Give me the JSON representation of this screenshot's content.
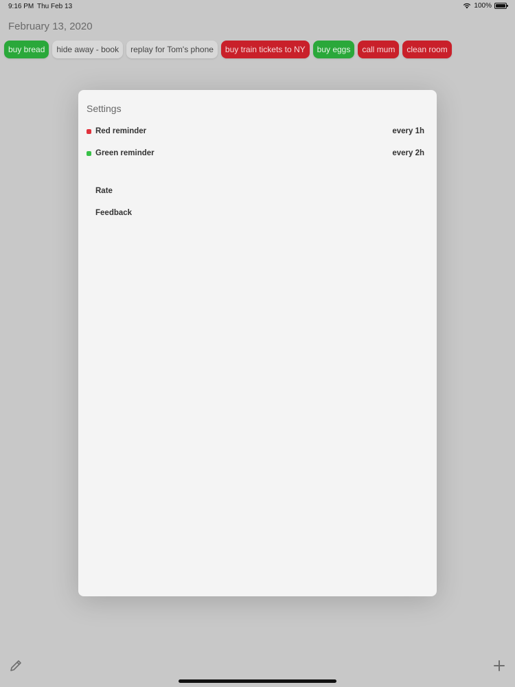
{
  "status_bar": {
    "time": "9:16 PM",
    "date": "Thu Feb 13",
    "battery": "100%",
    "battery_level": 1.0
  },
  "header": {
    "date": "February 13, 2020"
  },
  "reminders": [
    {
      "label": "buy bread",
      "color": "green"
    },
    {
      "label": "hide away - book",
      "color": "gray"
    },
    {
      "label": "replay for Tom's phone",
      "color": "gray"
    },
    {
      "label": "buy train tickets to NY",
      "color": "red"
    },
    {
      "label": "buy eggs",
      "color": "green"
    },
    {
      "label": "call mum",
      "color": "red"
    },
    {
      "label": "clean room",
      "color": "red"
    }
  ],
  "colors": {
    "green": "#2aa83a",
    "red": "#c9202a",
    "gray": "#d8d8d8"
  },
  "settings": {
    "title": "Settings",
    "red_reminder": {
      "label": "Red reminder",
      "value": "every 1h"
    },
    "green_reminder": {
      "label": "Green reminder",
      "value": "every 2h"
    },
    "rate": "Rate",
    "feedback": "Feedback"
  },
  "icons": {
    "edit": "pencil-icon",
    "add": "plus-icon",
    "wifi": "wifi-icon",
    "battery": "battery-icon"
  }
}
